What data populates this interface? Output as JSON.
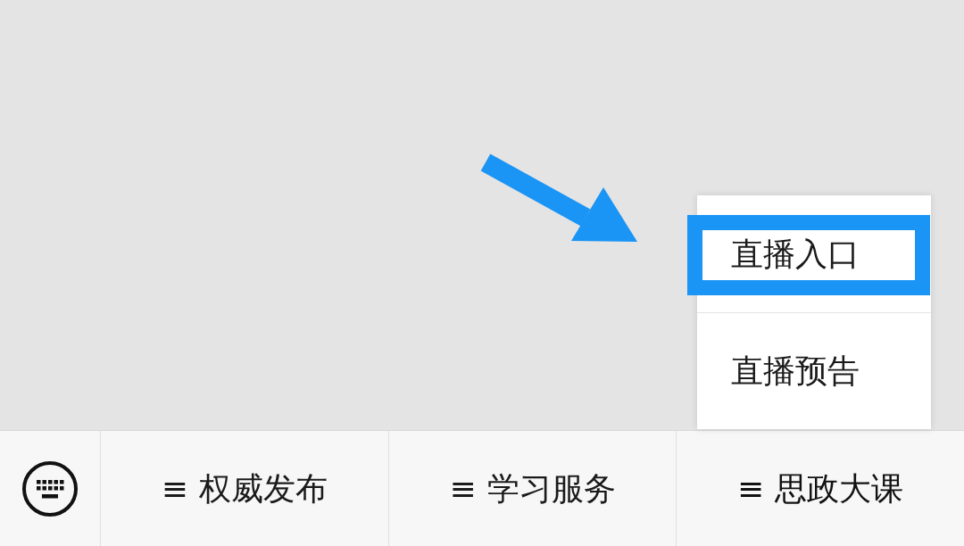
{
  "menu_bar": {
    "keyboard_toggle": true,
    "menus": [
      {
        "mark": "≡",
        "label": "权威发布",
        "expanded": false
      },
      {
        "mark": "≡",
        "label": "学习服务",
        "expanded": false
      },
      {
        "mark": "≡",
        "label": "思政大课",
        "expanded": true
      }
    ]
  },
  "submenu": {
    "items": [
      {
        "label": "直播入口",
        "highlighted": true
      },
      {
        "label": "直播预告",
        "highlighted": false
      }
    ]
  },
  "annotation_arrow": true
}
